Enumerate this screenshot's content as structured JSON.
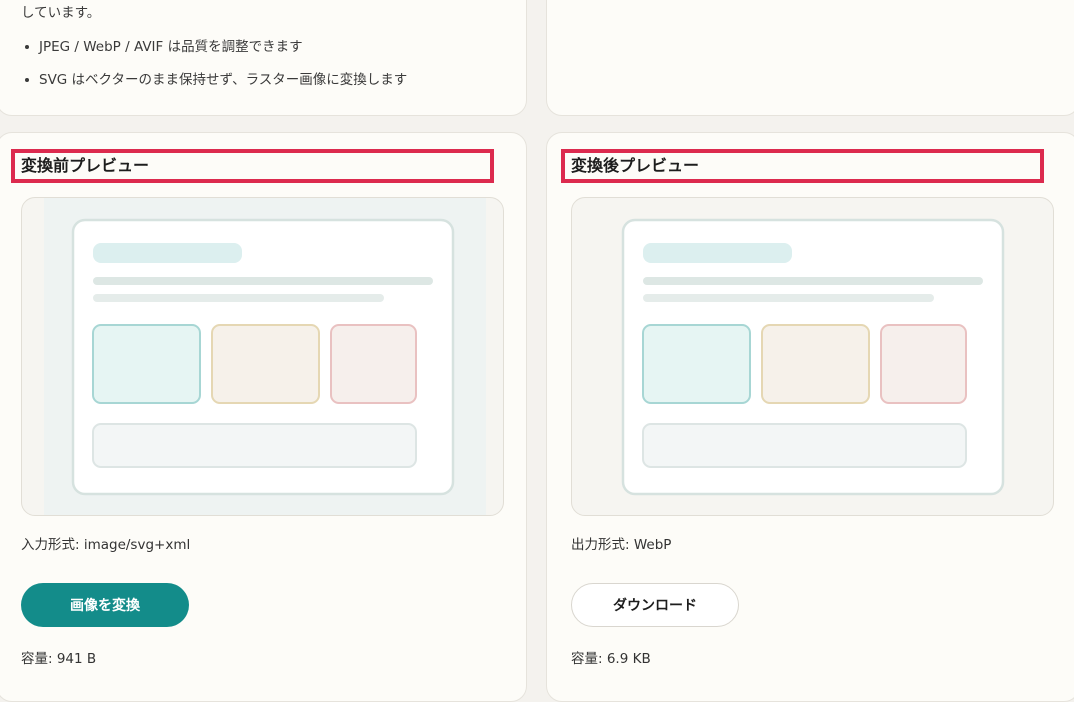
{
  "top_left": {
    "intro_text": "しています。",
    "bullets": [
      "JPEG / WebP / AVIF は品質を調整できます",
      "SVG はベクターのまま保持せず、ラスター画像に変換します"
    ]
  },
  "before": {
    "title": "変換前プレビュー",
    "format_label": "入力形式: image/svg+xml",
    "button_label": "画像を変換",
    "size_label": "容量: 941 B"
  },
  "after": {
    "title": "変換後プレビュー",
    "format_label": "出力形式: WebP",
    "button_label": "ダウンロード",
    "size_label": "容量: 6.9 KB"
  },
  "colors": {
    "accent": "#138c8a",
    "highlight_border": "#dc2a4e",
    "tile_teal": "#e6f5f3",
    "tile_sand": "#f6f1ea",
    "tile_rose": "#f6efec"
  }
}
